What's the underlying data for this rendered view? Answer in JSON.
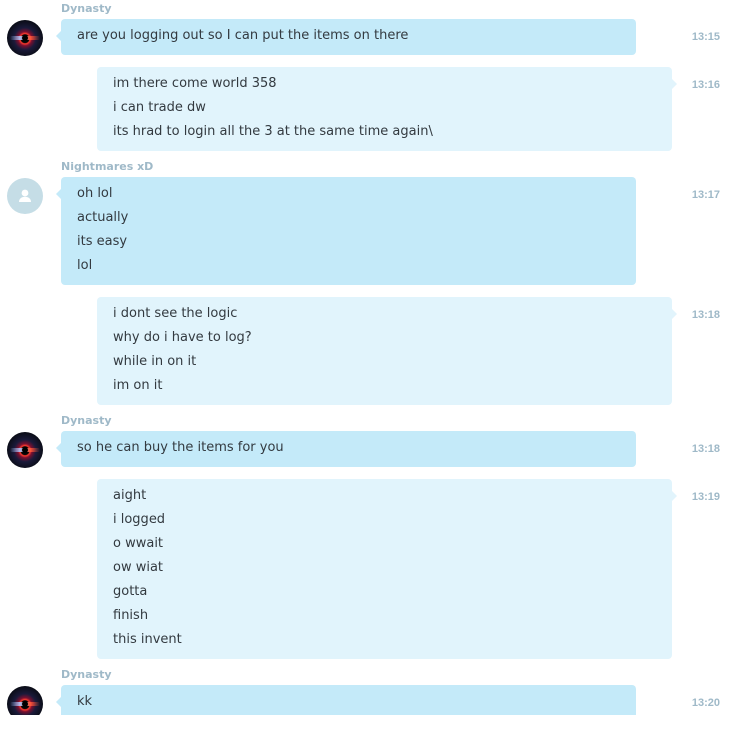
{
  "messages": [
    {
      "sender": "Dynasty",
      "side": "them",
      "avatar": "dynasty",
      "time": "13:15",
      "lines": [
        "are you logging out so I can put the items on there"
      ]
    },
    {
      "sender": "",
      "side": "me",
      "avatar": "",
      "time": "13:16",
      "lines": [
        "im there come world 358",
        "i can trade dw",
        "its hrad to login all the 3 at the same time again\\"
      ]
    },
    {
      "sender": "Nightmares xD",
      "side": "them",
      "avatar": "default",
      "time": "13:17",
      "lines": [
        "oh lol",
        "actually",
        "its easy",
        "lol"
      ]
    },
    {
      "sender": "",
      "side": "me",
      "avatar": "",
      "time": "13:18",
      "lines": [
        "i dont see the logic",
        "why do i have to log?",
        "while in on it",
        "im on it"
      ]
    },
    {
      "sender": "Dynasty",
      "side": "them",
      "avatar": "dynasty",
      "time": "13:18",
      "lines": [
        "so he can buy the items for you"
      ]
    },
    {
      "sender": "",
      "side": "me",
      "avatar": "",
      "time": "13:19",
      "lines": [
        "aight",
        "i logged",
        "o wwait",
        "ow wiat",
        "gotta",
        "finish",
        "this invent"
      ]
    },
    {
      "sender": "Dynasty",
      "side": "them",
      "avatar": "dynasty",
      "time": "13:20",
      "lines": [
        "kk"
      ]
    }
  ]
}
